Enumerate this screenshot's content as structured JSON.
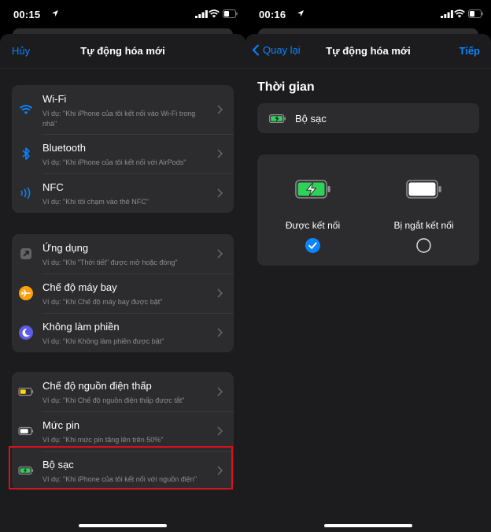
{
  "left": {
    "status": {
      "time": "00:15"
    },
    "nav": {
      "cancel": "Hủy",
      "title": "Tự động hóa mới"
    },
    "groups": [
      [
        {
          "icon": "wifi-icon",
          "title": "Wi-Fi",
          "sub": "Ví dụ: \"Khi iPhone của tôi kết nối vào Wi-Fi trong nhà\""
        },
        {
          "icon": "bluetooth-icon",
          "title": "Bluetooth",
          "sub": "Ví dụ: \"Khi iPhone của tôi kết nối với AirPods\""
        },
        {
          "icon": "nfc-icon",
          "title": "NFC",
          "sub": "Ví dụ: \"Khi tôi chạm vào thẻ NFC\""
        }
      ],
      [
        {
          "icon": "app-icon",
          "title": "Ứng dụng",
          "sub": "Ví dụ: \"Khi \"Thời tiết\" được mở hoặc đóng\""
        },
        {
          "icon": "airplane-icon",
          "title": "Chế độ máy bay",
          "sub": "Ví dụ: \"Khi Chế độ máy bay được bật\""
        },
        {
          "icon": "moon-icon",
          "title": "Không làm phiền",
          "sub": "Ví dụ: \"Khi Không làm phiền được bật\""
        }
      ],
      [
        {
          "icon": "low-power-battery-icon",
          "title": "Chế độ nguồn điện thấp",
          "sub": "Ví dụ: \"Khi Chế độ nguồn điện thấp được tắt\""
        },
        {
          "icon": "battery-level-icon",
          "title": "Mức pin",
          "sub": "Ví dụ: \"Khi mức pin tăng lên trên 50%\""
        },
        {
          "icon": "charging-battery-icon",
          "title": "Bộ sạc",
          "sub": "Ví dụ: \"Khi iPhone của tôi kết nối với nguồn điện\""
        }
      ]
    ]
  },
  "right": {
    "status": {
      "time": "00:16"
    },
    "nav": {
      "back": "Quay lại",
      "title": "Tự động hóa mới",
      "next": "Tiếp"
    },
    "section_title": "Thời gian",
    "trigger_label": "Bộ sạc",
    "options": {
      "connected": {
        "label": "Được kết nối",
        "selected": true
      },
      "disconnected": {
        "label": "Bị ngắt kết nối",
        "selected": false
      }
    }
  },
  "colors": {
    "accent": "#0a84ff",
    "highlight": "#d8121a",
    "charging": "#30d158",
    "low_power": "#ffd60a"
  }
}
